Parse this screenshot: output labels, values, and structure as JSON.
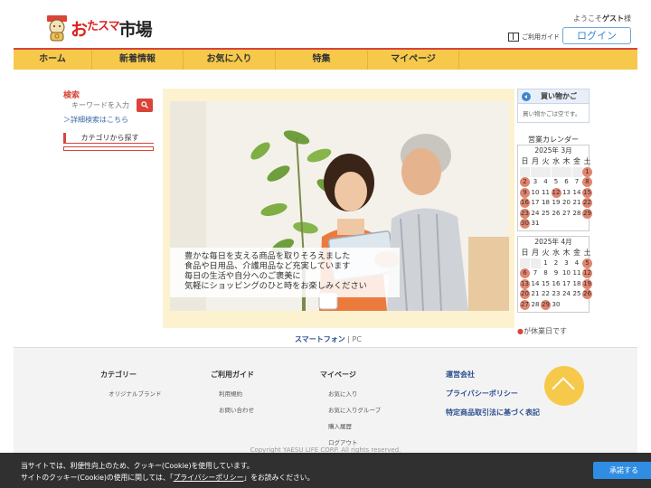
{
  "header": {
    "logo": {
      "o": "お",
      "ta": "たスマ",
      "ichiba": "市場"
    },
    "welcome_prefix": "ようこそ",
    "welcome_user": "ゲスト",
    "welcome_suffix": "様",
    "guide_label": "ご利用ガイド",
    "login_label": "ログイン"
  },
  "nav": {
    "items": [
      "ホーム",
      "新着情報",
      "お気に入り",
      "特集",
      "マイページ"
    ]
  },
  "sidebar": {
    "search_title": "検索",
    "search_placeholder": "キーワードを入力",
    "advanced_search": "＞詳細検索はこちら",
    "category_label": "カテゴリから探す"
  },
  "hero": {
    "caption_lines": [
      "豊かな毎日を支える商品を取りそろえました",
      "食品や日用品、介護用品など充実しています",
      "毎日の生活や自分へのご褒美に",
      "気軽にショッピングのひと時をお楽しみください"
    ]
  },
  "device_links": {
    "smartphone": "スマートフォン",
    "separator": " | ",
    "pc": "PC"
  },
  "cart": {
    "title": "買い物かご",
    "empty_text": "買い物かごは空です。"
  },
  "calendar": {
    "title": "営業カレンダー",
    "weekdays": [
      "日",
      "月",
      "火",
      "水",
      "木",
      "金",
      "土"
    ],
    "months": [
      {
        "label": "2025年 3月",
        "leading_blanks": 6,
        "days": 31,
        "holidays": [
          1,
          2,
          8,
          9,
          12,
          15,
          16,
          22,
          23,
          29,
          30
        ]
      },
      {
        "label": "2025年 4月",
        "leading_blanks": 2,
        "days": 30,
        "holidays": [
          5,
          6,
          12,
          13,
          19,
          20,
          26,
          27,
          29
        ]
      }
    ],
    "holiday_note_mark": "●",
    "holiday_note": "が休業日です",
    "colors": {
      "holiday": "#e0856f"
    }
  },
  "footer": {
    "columns": [
      {
        "head": "カテゴリー",
        "links": [
          "オリジナルブランド"
        ]
      },
      {
        "head": "ご利用ガイド",
        "links": [
          "利用規約",
          "お問い合わせ"
        ]
      },
      {
        "head": "マイページ",
        "links": [
          "お気に入り",
          "お気に入りグループ",
          "購入履歴",
          "ログアウト"
        ]
      }
    ],
    "company_links": [
      "運営会社",
      "プライバシーポリシー",
      "特定商品取引法に基づく表記"
    ],
    "copyright": "Copyright YAESU LIFE CORP. All rights reserved."
  },
  "cookie": {
    "line1": "当サイトでは、利便性向上のため、クッキー(Cookie)を使用しています。",
    "line2_prefix": "サイトのクッキー(Cookie)の使用に関しては、「",
    "line2_link": "プライバシーポリシー",
    "line2_suffix": "」をお読みください。",
    "accept_label": "承諾する"
  },
  "colors": {
    "accent_red": "#d9443a",
    "nav_yellow": "#f6c94a",
    "link_blue": "#2b4d8c",
    "cookie_button": "#2f8de4"
  }
}
